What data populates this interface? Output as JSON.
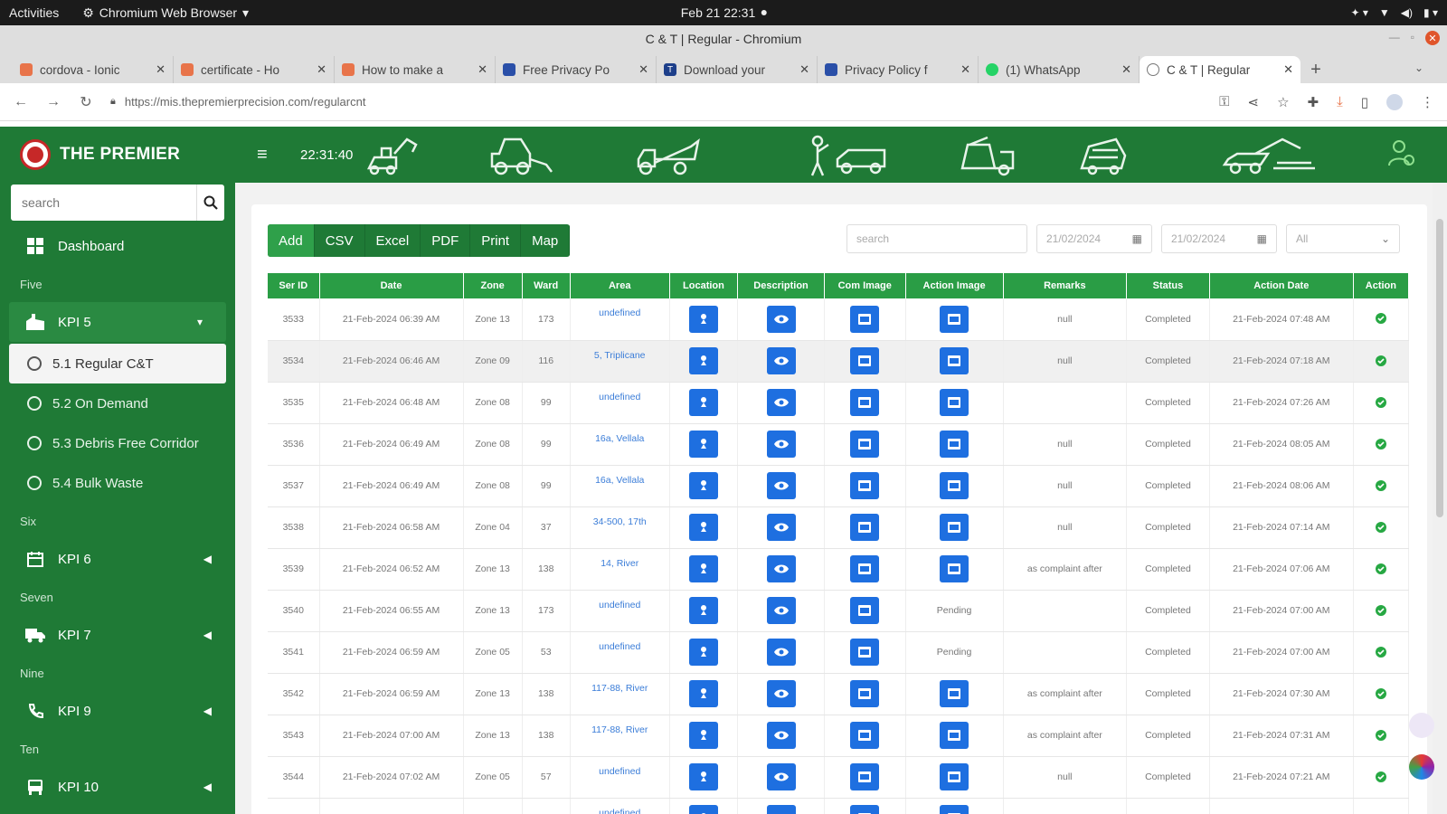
{
  "os": {
    "activities": "Activities",
    "app_name": "Chromium Web Browser",
    "datetime": "Feb 21  22:31"
  },
  "window": {
    "title": "C & T | Regular - Chromium"
  },
  "tabs": [
    {
      "label": "cordova - Ionic",
      "color": "#e8744a"
    },
    {
      "label": "certificate - Ho",
      "color": "#e8744a"
    },
    {
      "label": "How to make a",
      "color": "#e8744a"
    },
    {
      "label": "Free Privacy Po",
      "color": "#2a4fa8"
    },
    {
      "label": "Download your",
      "color": "#1d3f8a"
    },
    {
      "label": "Privacy Policy f",
      "color": "#2a4fa8"
    },
    {
      "label": "(1) WhatsApp",
      "color": "#25d366"
    },
    {
      "label": "C & T | Regular",
      "color": "#777777"
    }
  ],
  "address": {
    "url": "https://mis.thepremierprecision.com/regularcnt"
  },
  "header": {
    "brand": "THE PREMIER",
    "time": "22:31:40"
  },
  "sidebar": {
    "search_placeholder": "search",
    "dashboard": "Dashboard",
    "sections": {
      "five": "Five",
      "six": "Six",
      "seven": "Seven",
      "nine": "Nine",
      "ten": "Ten"
    },
    "kpi5": "KPI 5",
    "sub": [
      "5.1 Regular C&T",
      "5.2 On Demand",
      "5.3 Debris Free Corridor",
      "5.4 Bulk Waste"
    ],
    "kpi6": "KPI 6",
    "kpi7": "KPI 7",
    "kpi9": "KPI 9",
    "kpi10": "KPI 10"
  },
  "toolbar": {
    "buttons": [
      "Add",
      "CSV",
      "Excel",
      "PDF",
      "Print",
      "Map"
    ]
  },
  "filters": {
    "search_placeholder": "search",
    "from_date": "21/02/2024",
    "to_date": "21/02/2024",
    "select": "All"
  },
  "table": {
    "columns": [
      "Ser ID",
      "Date",
      "Zone",
      "Ward",
      "Area",
      "Location",
      "Description",
      "Com Image",
      "Action Image",
      "Remarks",
      "Status",
      "Action Date",
      "Action"
    ],
    "rows": [
      {
        "id": "3533",
        "date": "21-Feb-2024 06:39 AM",
        "zone": "Zone 13",
        "ward": "173",
        "area": "undefined",
        "action_image": "button",
        "remarks": "null",
        "status": "Completed",
        "action_date": "21-Feb-2024 07:48 AM"
      },
      {
        "id": "3534",
        "date": "21-Feb-2024 06:46 AM",
        "zone": "Zone 09",
        "ward": "116",
        "area": "5, Triplicane",
        "action_image": "button",
        "remarks": "null",
        "status": "Completed",
        "action_date": "21-Feb-2024 07:18 AM"
      },
      {
        "id": "3535",
        "date": "21-Feb-2024 06:48 AM",
        "zone": "Zone 08",
        "ward": "99",
        "area": "undefined",
        "action_image": "button",
        "remarks": "",
        "status": "Completed",
        "action_date": "21-Feb-2024 07:26 AM"
      },
      {
        "id": "3536",
        "date": "21-Feb-2024 06:49 AM",
        "zone": "Zone 08",
        "ward": "99",
        "area": "16a, Vellala",
        "action_image": "button",
        "remarks": "null",
        "status": "Completed",
        "action_date": "21-Feb-2024 08:05 AM"
      },
      {
        "id": "3537",
        "date": "21-Feb-2024 06:49 AM",
        "zone": "Zone 08",
        "ward": "99",
        "area": "16a, Vellala",
        "action_image": "button",
        "remarks": "null",
        "status": "Completed",
        "action_date": "21-Feb-2024 08:06 AM"
      },
      {
        "id": "3538",
        "date": "21-Feb-2024 06:58 AM",
        "zone": "Zone 04",
        "ward": "37",
        "area": "34-500, 17th",
        "action_image": "button",
        "remarks": "null",
        "status": "Completed",
        "action_date": "21-Feb-2024 07:14 AM"
      },
      {
        "id": "3539",
        "date": "21-Feb-2024 06:52 AM",
        "zone": "Zone 13",
        "ward": "138",
        "area": "14, River",
        "action_image": "button",
        "remarks": "as complaint after",
        "status": "Completed",
        "action_date": "21-Feb-2024 07:06 AM"
      },
      {
        "id": "3540",
        "date": "21-Feb-2024 06:55 AM",
        "zone": "Zone 13",
        "ward": "173",
        "area": "undefined",
        "action_image": "Pending",
        "remarks": "",
        "status": "Completed",
        "action_date": "21-Feb-2024 07:00 AM"
      },
      {
        "id": "3541",
        "date": "21-Feb-2024 06:59 AM",
        "zone": "Zone 05",
        "ward": "53",
        "area": "undefined",
        "action_image": "Pending",
        "remarks": "",
        "status": "Completed",
        "action_date": "21-Feb-2024 07:00 AM"
      },
      {
        "id": "3542",
        "date": "21-Feb-2024 06:59 AM",
        "zone": "Zone 13",
        "ward": "138",
        "area": "117-88, River",
        "action_image": "button",
        "remarks": "as complaint after",
        "status": "Completed",
        "action_date": "21-Feb-2024 07:30 AM"
      },
      {
        "id": "3543",
        "date": "21-Feb-2024 07:00 AM",
        "zone": "Zone 13",
        "ward": "138",
        "area": "117-88, River",
        "action_image": "button",
        "remarks": "as complaint after",
        "status": "Completed",
        "action_date": "21-Feb-2024 07:31 AM"
      },
      {
        "id": "3544",
        "date": "21-Feb-2024 07:02 AM",
        "zone": "Zone 05",
        "ward": "57",
        "area": "undefined",
        "action_image": "button",
        "remarks": "null",
        "status": "Completed",
        "action_date": "21-Feb-2024 07:21 AM"
      },
      {
        "id": "",
        "date": "",
        "zone": "",
        "ward": "",
        "area": "undefined",
        "action_image": "button",
        "remarks": "",
        "status": "",
        "action_date": ""
      }
    ]
  },
  "colors": {
    "brand_green": "#1f7a36",
    "header_green": "#2a9d45",
    "icon_blue": "#1e6fe0",
    "ok_green": "#27a843"
  }
}
